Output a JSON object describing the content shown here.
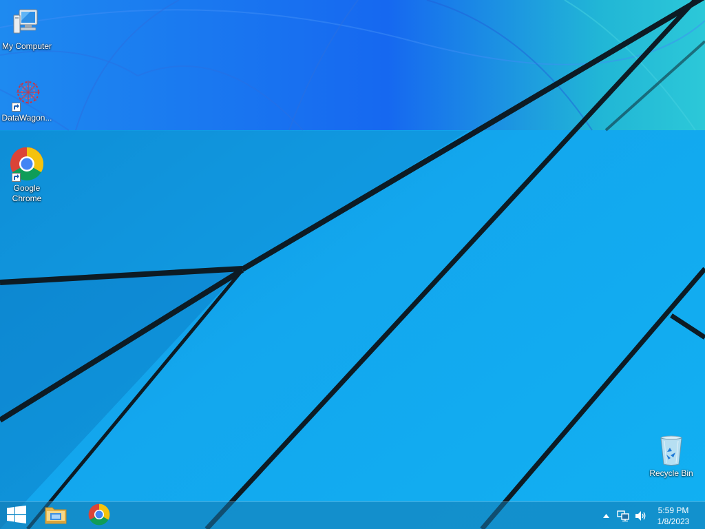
{
  "desktop": {
    "icons": [
      {
        "label": "My Computer",
        "icon": "computer-icon"
      },
      {
        "label": "DataWagon...",
        "icon": "datawagon-icon"
      },
      {
        "label": "Google Chrome",
        "icon": "chrome-icon"
      },
      {
        "label": "Recycle Bin",
        "icon": "recycle-bin-icon"
      }
    ]
  },
  "taskbar": {
    "start_icon": "windows-start-icon",
    "pinned": [
      {
        "name": "file-explorer",
        "icon": "folder-icon"
      },
      {
        "name": "google-chrome",
        "icon": "chrome-icon"
      }
    ],
    "tray": {
      "icons": [
        "show-hidden-icons-chevron",
        "network-icon",
        "volume-icon"
      ],
      "time": "5:59 PM",
      "date": "1/8/2023"
    }
  },
  "colors": {
    "wallpaper_base": "#12a3ea",
    "wallpaper_top_band": "#1473f0",
    "accent_teal": "#2cc6d8",
    "line": "#0c1f2a",
    "text": "#ffffff"
  }
}
